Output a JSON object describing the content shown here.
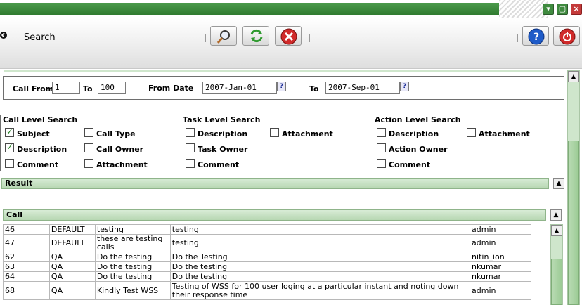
{
  "toolbar": {
    "title": "Search",
    "back_icon": "back-arrow-icon",
    "search_icon": "magnifier-icon",
    "refresh_icon": "refresh-icon",
    "cancel_icon": "cancel-x-icon",
    "help_icon": "help-icon",
    "exit_icon": "power-icon"
  },
  "filters": {
    "call_from_label": "Call From",
    "call_from_value": "1",
    "to_label": "To",
    "to_value": "100",
    "from_date_label": "From Date",
    "from_date_value": "2007-Jan-01",
    "to_date_label": "To",
    "to_date_value": "2007-Sep-01",
    "help_glyph": "?"
  },
  "call_level": {
    "heading": "Call Level Search",
    "items": [
      {
        "label": "Subject",
        "checked": true
      },
      {
        "label": "Call Type",
        "checked": false
      },
      {
        "label": "Description",
        "checked": true
      },
      {
        "label": "Call Owner",
        "checked": false
      },
      {
        "label": "Comment",
        "checked": false
      },
      {
        "label": "Attachment",
        "checked": false
      }
    ]
  },
  "task_level": {
    "heading": "Task Level Search",
    "items": [
      {
        "label": "Description",
        "checked": false
      },
      {
        "label": "Attachment",
        "checked": false
      },
      {
        "label": "Task Owner",
        "checked": false
      },
      {
        "label": "Comment",
        "checked": false
      }
    ]
  },
  "action_level": {
    "heading": "Action Level Search",
    "items": [
      {
        "label": "Description",
        "checked": false
      },
      {
        "label": "Attachment",
        "checked": false
      },
      {
        "label": "Action Owner",
        "checked": false
      },
      {
        "label": "Comment",
        "checked": false
      }
    ]
  },
  "result": {
    "heading": "Result",
    "call_heading": "Call",
    "rows": [
      {
        "id": "46",
        "type": "DEFAULT",
        "subject": "testing",
        "description": "testing",
        "owner": "admin"
      },
      {
        "id": "47",
        "type": "DEFAULT",
        "subject": "these are testing calls",
        "description": "testing",
        "owner": "admin"
      },
      {
        "id": "62",
        "type": "QA",
        "subject": "Do the testing",
        "description": "Do the Testing",
        "owner": "nitin_ion"
      },
      {
        "id": "63",
        "type": "QA",
        "subject": "Do the testing",
        "description": "Do the testing",
        "owner": "nkumar"
      },
      {
        "id": "64",
        "type": "QA",
        "subject": "Do the testing",
        "description": "Do the testing",
        "owner": "nkumar"
      },
      {
        "id": "68",
        "type": "QA",
        "subject": "Kindly Test WSS",
        "description": "Testing of WSS for 100 user loging at a particular instant and noting down their response time",
        "owner": "admin"
      }
    ]
  },
  "colors": {
    "title_green": "#2f7a2f",
    "section_bar": "#b7d7b2",
    "check_green": "#1b7a1b"
  }
}
